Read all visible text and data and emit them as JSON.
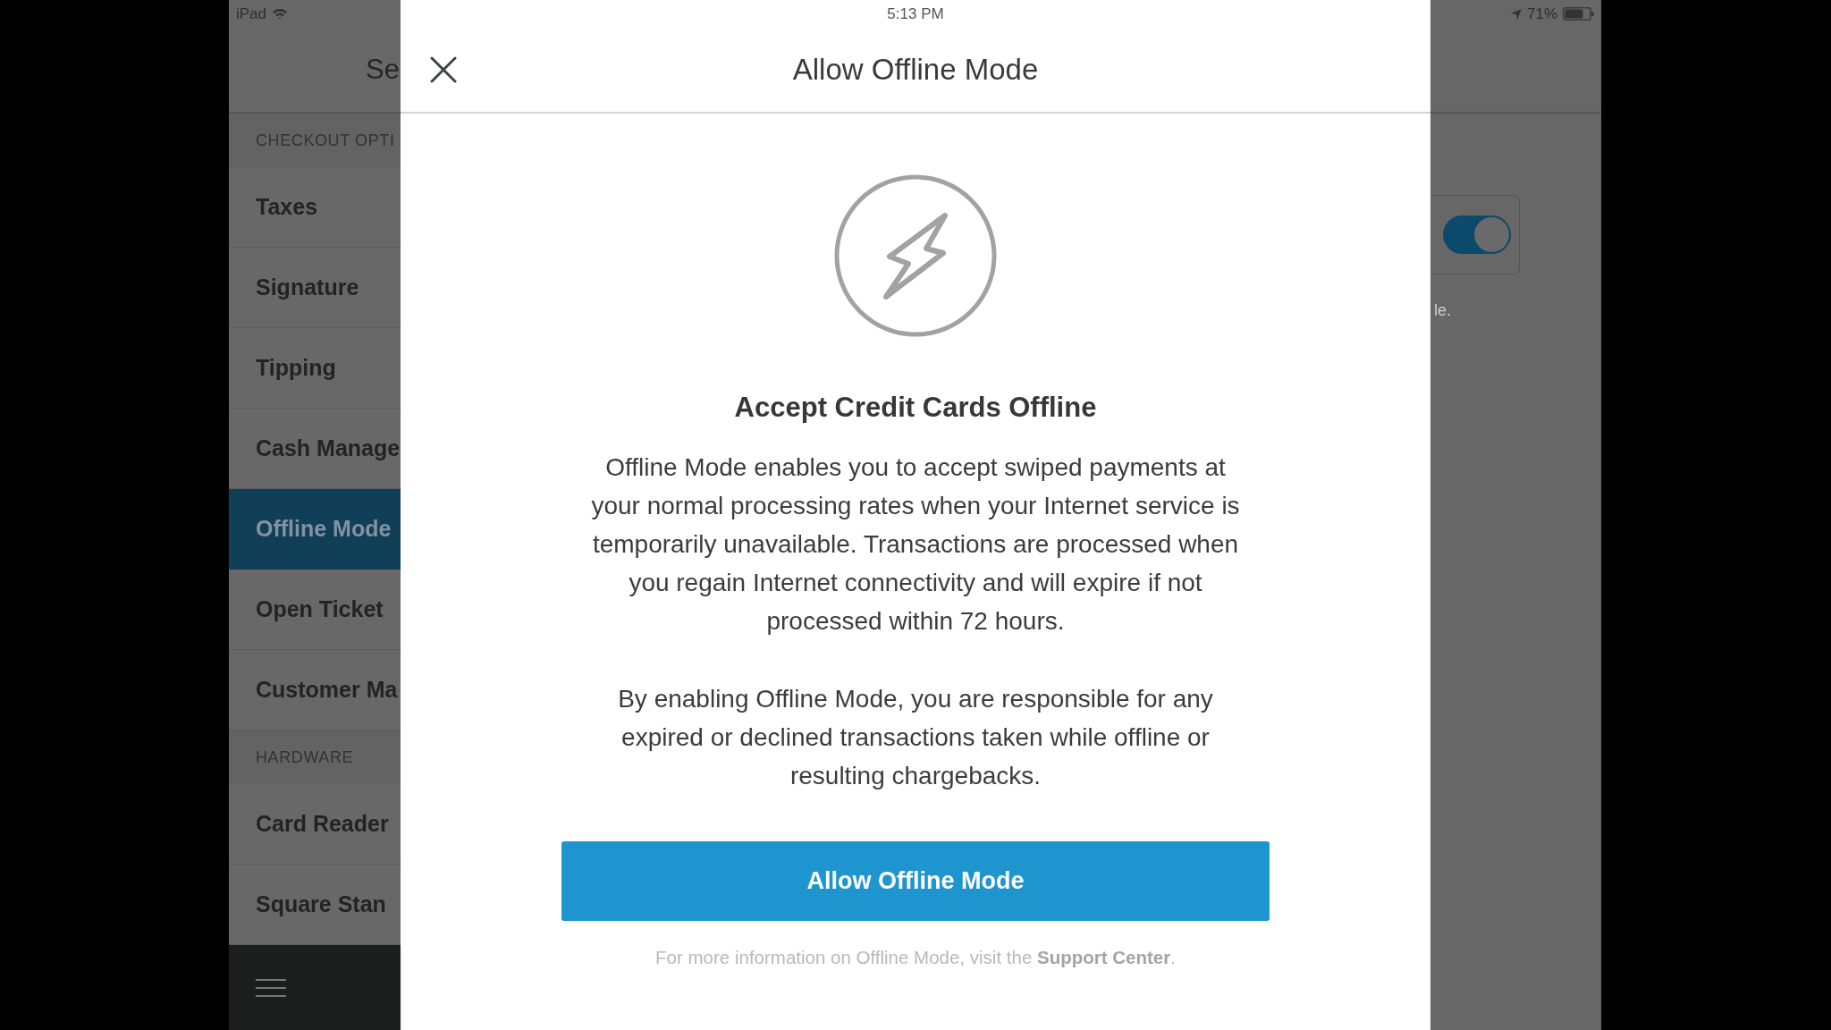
{
  "status_bar": {
    "device": "iPad",
    "time": "5:13 PM",
    "battery": "71%"
  },
  "sidebar": {
    "title": "Se",
    "sections": [
      {
        "heading": "CHECKOUT OPTI",
        "items": [
          {
            "label": "Taxes",
            "selected": false
          },
          {
            "label": "Signature",
            "selected": false
          },
          {
            "label": "Tipping",
            "selected": false
          },
          {
            "label": "Cash Manage",
            "selected": false
          },
          {
            "label": "Offline Mode",
            "selected": true
          },
          {
            "label": "Open Ticket",
            "selected": false
          },
          {
            "label": "Customer Ma",
            "selected": false
          }
        ]
      },
      {
        "heading": "HARDWARE",
        "items": [
          {
            "label": "Card Reader",
            "selected": false
          },
          {
            "label": "Square Stan",
            "selected": false
          }
        ]
      }
    ]
  },
  "modal": {
    "title": "Allow Offline Mode",
    "heading": "Accept Credit Cards Offline",
    "paragraphs": [
      "Offline Mode enables you to accept swiped payments at your normal processing rates when your Internet service is temporarily unavailable. Transactions are processed when you regain Internet connectivity and will expire if not processed within 72 hours.",
      "By enabling Offline Mode, you are responsible for any expired or declined transactions taken while offline or resulting chargebacks."
    ],
    "button": "Allow Offline Mode",
    "footer": {
      "text_before": "For more information on Offline Mode, visit the ",
      "link": "Support Center",
      "text_after": "."
    }
  },
  "settings_panel": {
    "toggle": {
      "on": true
    },
    "caption": "le."
  }
}
